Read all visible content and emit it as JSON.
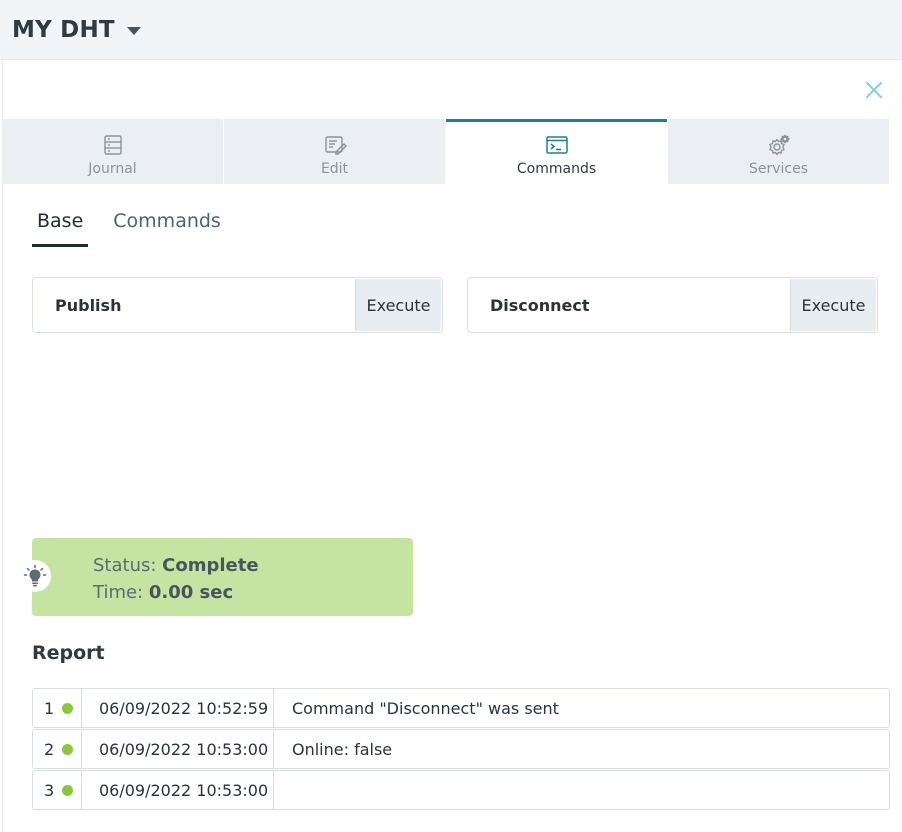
{
  "header": {
    "title": "MY DHT"
  },
  "tabs": [
    {
      "label": "Journal",
      "icon": "journal-icon"
    },
    {
      "label": "Edit",
      "icon": "edit-icon"
    },
    {
      "label": "Commands",
      "icon": "terminal-icon",
      "active": true
    },
    {
      "label": "Services",
      "icon": "gear-icon"
    }
  ],
  "subtabs": [
    {
      "label": "Base",
      "active": true
    },
    {
      "label": "Commands"
    }
  ],
  "commands": [
    {
      "label": "Publish",
      "button": "Execute"
    },
    {
      "label": "Disconnect",
      "button": "Execute"
    }
  ],
  "status": {
    "status_label": "Status:",
    "status_value": "Complete",
    "time_label": "Time:",
    "time_value": "0.00 sec",
    "icon": "lightbulb-icon",
    "color": "#c5e3a1"
  },
  "report": {
    "title": "Report",
    "rows": [
      {
        "num": "1",
        "time": "06/09/2022 10:52:59",
        "message": "Command \"Disconnect\" was sent"
      },
      {
        "num": "2",
        "time": "06/09/2022 10:53:00",
        "message": "Online: false"
      },
      {
        "num": "3",
        "time": "06/09/2022 10:53:00",
        "message": ""
      }
    ],
    "dot_color": "#8cc63f"
  },
  "colors": {
    "accent": "#1e7d9c",
    "close": "#7fd0e0"
  }
}
